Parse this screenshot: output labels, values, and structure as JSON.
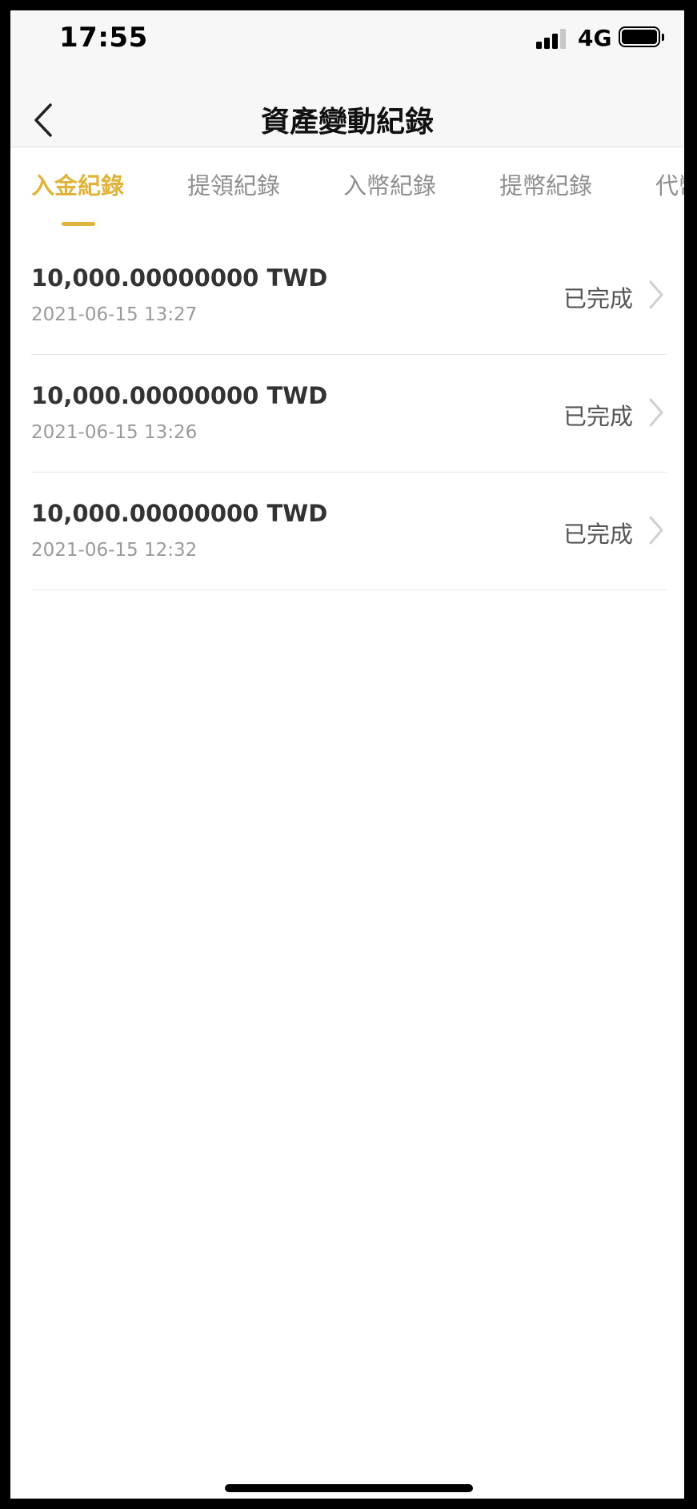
{
  "status_bar": {
    "time": "17:55",
    "network": "4G",
    "signal_icon": "cellular-signal-icon",
    "battery_icon": "battery-icon"
  },
  "header": {
    "back_icon": "chevron-left-icon",
    "title": "資產變動紀錄"
  },
  "tabs": [
    {
      "label": "入金紀錄",
      "active": true
    },
    {
      "label": "提領紀錄",
      "active": false
    },
    {
      "label": "入幣紀錄",
      "active": false
    },
    {
      "label": "提幣紀錄",
      "active": false
    },
    {
      "label": "代幣",
      "active": false
    }
  ],
  "records": [
    {
      "amount": "10,000.00000000 TWD",
      "time": "2021-06-15 13:27",
      "status": "已完成"
    },
    {
      "amount": "10,000.00000000 TWD",
      "time": "2021-06-15 13:26",
      "status": "已完成"
    },
    {
      "amount": "10,000.00000000 TWD",
      "time": "2021-06-15 12:32",
      "status": "已完成"
    }
  ],
  "colors": {
    "accent": "#e0b43a",
    "header_bg": "#f7f7f7",
    "text_primary": "#333333",
    "text_secondary": "#9a9a9a"
  }
}
